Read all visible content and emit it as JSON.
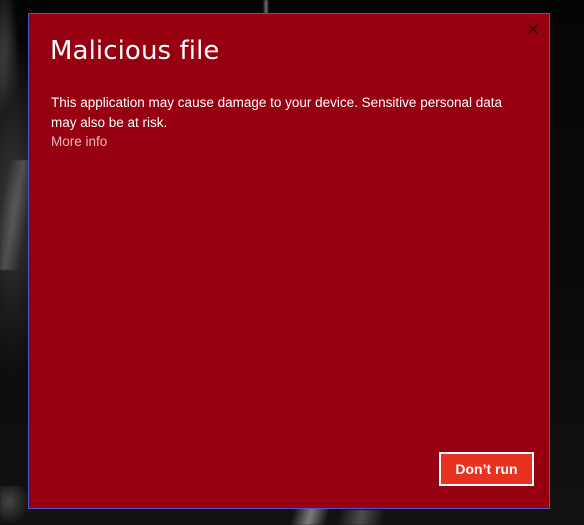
{
  "dialog": {
    "title": "Malicious file",
    "close_label": "×",
    "close_icon": "close-icon",
    "message": "This application may cause damage to your device. Sensitive personal data may also be at risk.",
    "more_info_label": "More info",
    "primary_button_label": "Don’t run"
  },
  "colors": {
    "dialog_background": "#960010",
    "dialog_border": "#4f56c8",
    "button_background": "#e8311f",
    "button_border": "#ffffff",
    "text": "#ffffff",
    "link_text": "#e9b7bd"
  }
}
